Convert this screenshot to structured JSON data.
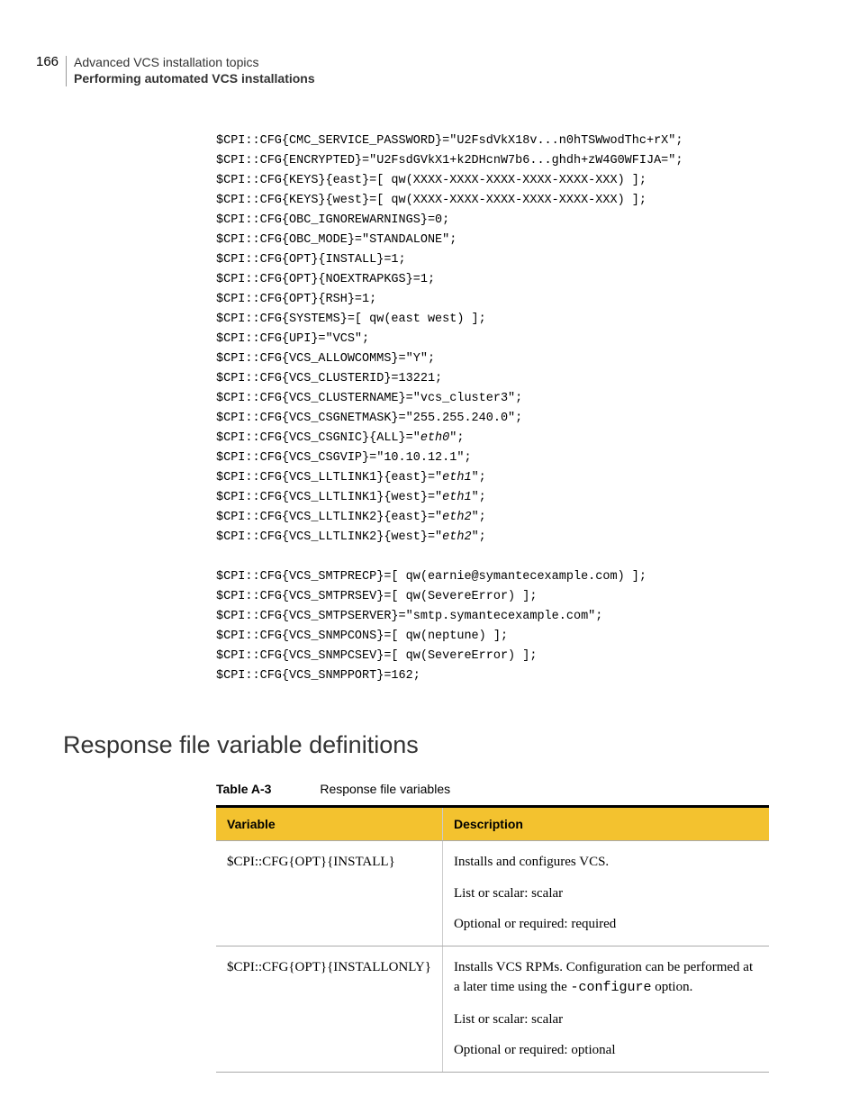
{
  "header": {
    "page_number": "166",
    "chapter": "Advanced VCS installation topics",
    "section": "Performing automated VCS installations"
  },
  "code": {
    "lines": [
      {
        "pre": "$CPI::CFG{CMC_SERVICE_PASSWORD}=\"U2FsdVkX18v...n0hTSWwodThc+rX\";"
      },
      {
        "pre": "$CPI::CFG{ENCRYPTED}=\"U2FsdGVkX1+k2DHcnW7b6...ghdh+zW4G0WFIJA=\";"
      },
      {
        "pre": "$CPI::CFG{KEYS}{east}=[ qw(XXXX-XXXX-XXXX-XXXX-XXXX-XXX) ];"
      },
      {
        "pre": "$CPI::CFG{KEYS}{west}=[ qw(XXXX-XXXX-XXXX-XXXX-XXXX-XXX) ];"
      },
      {
        "pre": "$CPI::CFG{OBC_IGNOREWARNINGS}=0;"
      },
      {
        "pre": "$CPI::CFG{OBC_MODE}=\"STANDALONE\";"
      },
      {
        "pre": "$CPI::CFG{OPT}{INSTALL}=1;"
      },
      {
        "pre": "$CPI::CFG{OPT}{NOEXTRAPKGS}=1;"
      },
      {
        "pre": "$CPI::CFG{OPT}{RSH}=1;"
      },
      {
        "pre": "$CPI::CFG{SYSTEMS}=[ qw(east west) ];"
      },
      {
        "pre": "$CPI::CFG{UPI}=\"VCS\";"
      },
      {
        "pre": "$CPI::CFG{VCS_ALLOWCOMMS}=\"Y\";"
      },
      {
        "pre": "$CPI::CFG{VCS_CLUSTERID}=13221;"
      },
      {
        "pre": "$CPI::CFG{VCS_CLUSTERNAME}=\"vcs_cluster3\";"
      },
      {
        "pre": "$CPI::CFG{VCS_CSGNETMASK}=\"255.255.240.0\";"
      },
      {
        "pre": "$CPI::CFG{VCS_CSGNIC}{ALL}=\"",
        "em": "eth0",
        "post": "\";"
      },
      {
        "pre": "$CPI::CFG{VCS_CSGVIP}=\"10.10.12.1\";"
      },
      {
        "pre": "$CPI::CFG{VCS_LLTLINK1}{east}=\"",
        "em": "eth1",
        "post": "\";"
      },
      {
        "pre": "$CPI::CFG{VCS_LLTLINK1}{west}=\"",
        "em": "eth1",
        "post": "\";"
      },
      {
        "pre": "$CPI::CFG{VCS_LLTLINK2}{east}=\"",
        "em": "eth2",
        "post": "\";"
      },
      {
        "pre": "$CPI::CFG{VCS_LLTLINK2}{west}=\"",
        "em": "eth2",
        "post": "\";"
      },
      {
        "blank": true
      },
      {
        "pre": "$CPI::CFG{VCS_SMTPRECP}=[ qw(earnie@symantecexample.com) ];"
      },
      {
        "pre": "$CPI::CFG{VCS_SMTPRSEV}=[ qw(SevereError) ];"
      },
      {
        "pre": "$CPI::CFG{VCS_SMTPSERVER}=\"smtp.symantecexample.com\";"
      },
      {
        "pre": "$CPI::CFG{VCS_SNMPCONS}=[ qw(neptune) ];"
      },
      {
        "pre": "$CPI::CFG{VCS_SNMPCSEV}=[ qw(SevereError) ];"
      },
      {
        "pre": "$CPI::CFG{VCS_SNMPPORT}=162;"
      }
    ]
  },
  "section_heading": "Response file variable definitions",
  "table": {
    "label": "Table A-3",
    "caption": "Response file variables",
    "headers": {
      "col1": "Variable",
      "col2": "Description"
    },
    "rows": [
      {
        "variable": "$CPI::CFG{OPT}{INSTALL}",
        "desc": [
          "Installs and configures VCS.",
          "List or scalar: scalar",
          "Optional or required: required"
        ]
      },
      {
        "variable": "$CPI::CFG{OPT}{INSTALLONLY}",
        "desc_special": {
          "lead": "Installs VCS RPMs. Configuration can be performed at a later time using the ",
          "mono": "-configure",
          "trail": " option."
        },
        "desc_rest": [
          "List or scalar: scalar",
          "Optional or required: optional"
        ]
      }
    ]
  }
}
